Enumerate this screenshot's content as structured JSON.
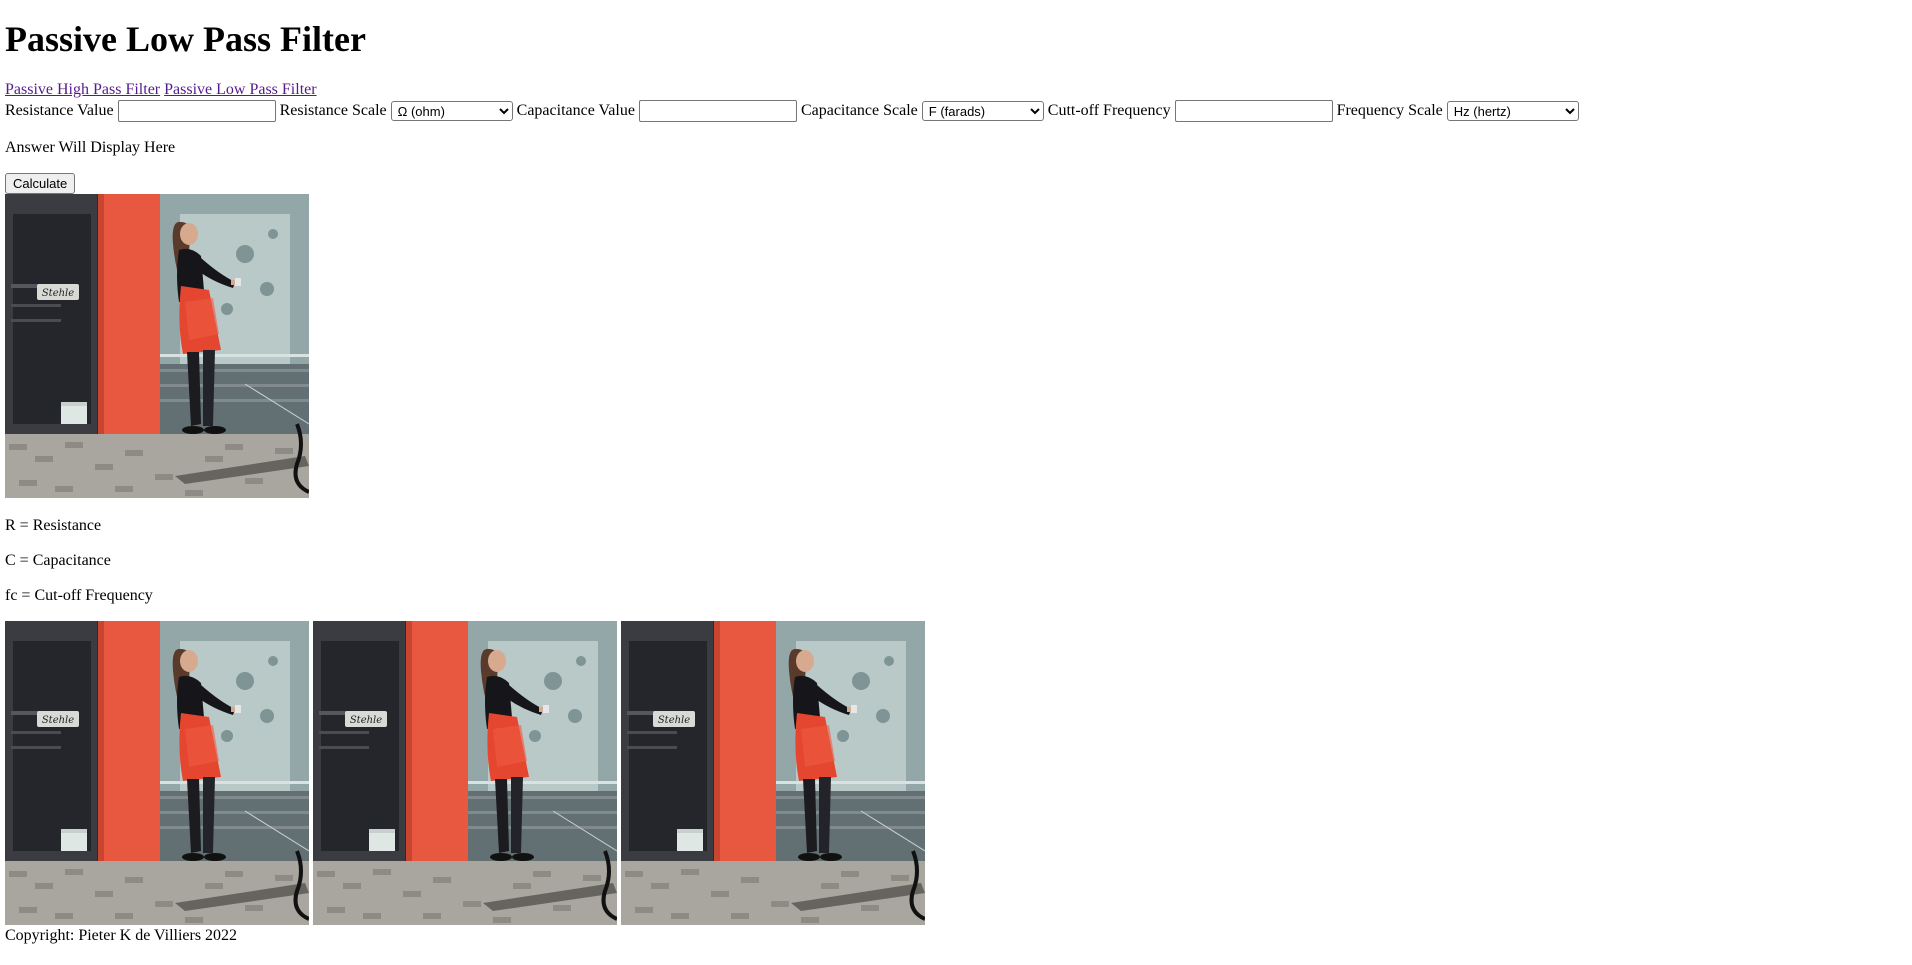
{
  "page": {
    "title": "Passive Low Pass Filter"
  },
  "nav": {
    "high_pass_link": "Passive High Pass Filter",
    "low_pass_link": "Passive Low Pass Filter"
  },
  "form": {
    "resistance_value_label": "Resistance Value",
    "resistance_value": "",
    "resistance_scale_label": "Resistance Scale",
    "resistance_scale_selected": "Ω (ohm)",
    "capacitance_value_label": "Capacitance Value",
    "capacitance_value": "",
    "capacitance_scale_label": "Capacitance Scale",
    "capacitance_scale_selected": "F (farads)",
    "cutoff_frequency_label": "Cutt-off Frequency",
    "cutoff_frequency_value": "",
    "frequency_scale_label": "Frequency Scale",
    "frequency_scale_selected": "Hz (hertz)"
  },
  "answer": {
    "text": "Answer Will Display Here"
  },
  "actions": {
    "calculate_label": "Calculate"
  },
  "legend": {
    "r": "R = Resistance",
    "c": "C = Capacitance",
    "fc": "fc = Cut-off Frequency"
  },
  "images": {
    "shop_sign": "Stehle"
  },
  "footer": {
    "copyright": "Copyright: Pieter K de Villiers 2022"
  },
  "colors": {
    "link": "#551a8b",
    "red_pillar": "#e8573f",
    "dress": "#e4462f"
  }
}
